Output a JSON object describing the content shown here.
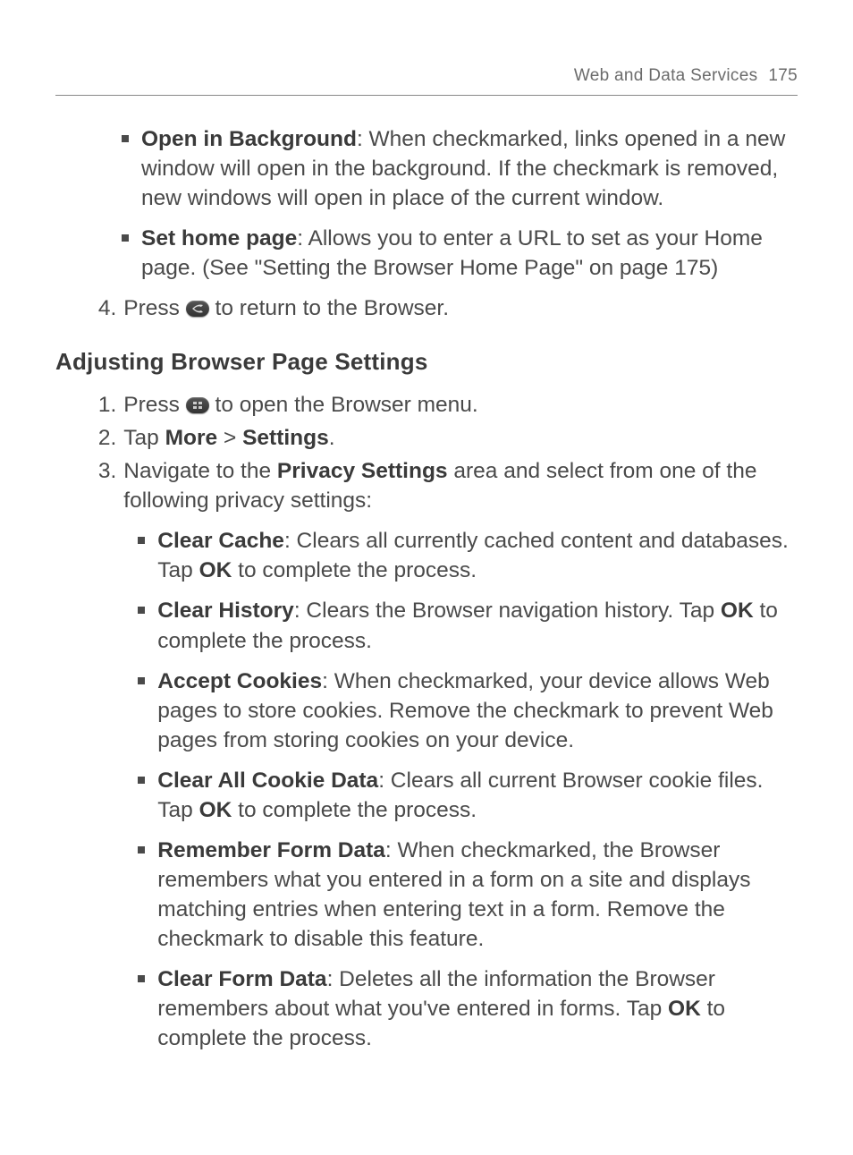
{
  "header": {
    "title": "Web and Data Services",
    "page": "175"
  },
  "top_bullets": [
    {
      "label": "Open in Background",
      "desc": ": When checkmarked, links opened in a new window will open in the background. If the checkmark is removed, new windows will open in place of the current window."
    },
    {
      "label": "Set home page",
      "desc": ": Allows you to enter a URL to set as your Home page. (See \"Setting the Browser Home Page\" on page 175)"
    }
  ],
  "step4": {
    "num": "4.",
    "pre": "Press ",
    "post": " to return to the Browser."
  },
  "section_title": "Adjusting Browser Page Settings",
  "steps": [
    {
      "num": "1.",
      "pre": "Press ",
      "post": " to open the Browser menu."
    },
    {
      "num": "2.",
      "a": "Tap ",
      "b": "More",
      "c": " > ",
      "d": "Settings",
      "e": "."
    },
    {
      "num": "3.",
      "a": "Navigate to the ",
      "b": "Privacy Settings",
      "c": " area and select from one of the following privacy settings:"
    }
  ],
  "privacy": [
    {
      "label": "Clear Cache",
      "d1": ": Clears all currently cached content and databases. Tap ",
      "ok": "OK",
      "d2": " to complete the process."
    },
    {
      "label": "Clear History",
      "d1": ": Clears the Browser navigation history. Tap ",
      "ok": "OK",
      "d2": " to complete the process."
    },
    {
      "label": "Accept Cookies",
      "d1": ": When checkmarked, your device allows Web pages to store cookies. Remove the checkmark to prevent Web pages from storing cookies on your device."
    },
    {
      "label": "Clear All Cookie Data",
      "d1": ": Clears all current Browser cookie files. Tap ",
      "ok": "OK",
      "d2": " to complete the process."
    },
    {
      "label": "Remember Form Data",
      "d1": ": When checkmarked, the Browser remembers what you entered in a form on a site and displays matching entries when entering text in a form. Remove the checkmark to disable this feature."
    },
    {
      "label": "Clear Form Data",
      "d1": ": Deletes all the information the Browser remembers about what you've entered in forms. Tap ",
      "ok": "OK",
      "d2": " to complete the process."
    }
  ]
}
